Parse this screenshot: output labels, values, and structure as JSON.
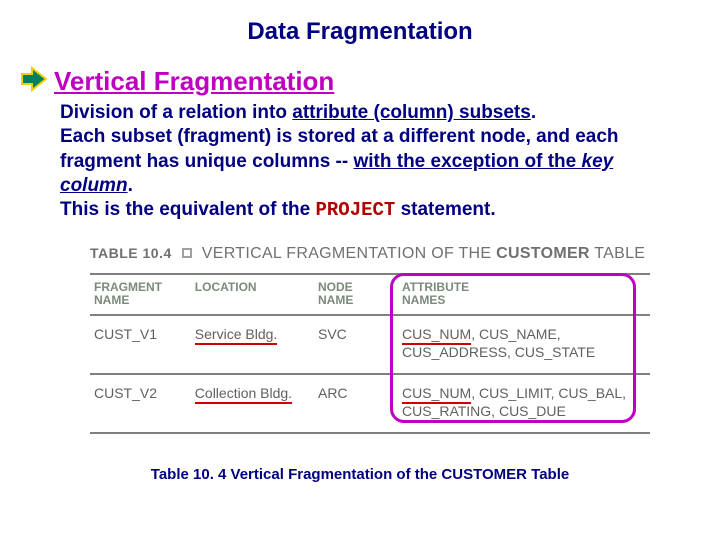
{
  "title": "Data Fragmentation",
  "section": {
    "heading": "Vertical Fragmentation",
    "bullet_shape": "right-arrow-block",
    "body_parts": {
      "p1a": "Division of a relation into ",
      "p1b": "attribute (column) subsets",
      "p1c": ".",
      "p2a": "Each subset (fragment) is stored at a different node, and each fragment has unique columns -- ",
      "p2b": "with the exception of the ",
      "p2c": "key column",
      "p2d": ".",
      "p3a": "This is the equivalent of the ",
      "p3code": "PROJECT",
      "p3b": " statement."
    }
  },
  "table": {
    "label": "TABLE 10.4",
    "title_plain": "VERTICAL FRAGMENTATION OF THE ",
    "title_bold": "CUSTOMER",
    "title_tail": " TABLE",
    "headers": {
      "fragment": "FRAGMENT\nNAME",
      "location": "LOCATION",
      "node": "NODE\nNAME",
      "attrs": "ATTRIBUTE\nNAMES"
    },
    "rows": [
      {
        "fragment": "CUST_V1",
        "location": "Service Bldg.",
        "node": "SVC",
        "attr_first": "CUS_NUM",
        "attr_rest": ", CUS_NAME, CUS_ADDRESS, CUS_STATE"
      },
      {
        "fragment": "CUST_V2",
        "location": "Collection Bldg.",
        "node": "ARC",
        "attr_first": "CUS_NUM",
        "attr_rest": ", CUS_LIMIT, CUS_BAL, CUS_RATING, CUS_DUE"
      }
    ]
  },
  "caption": "Table 10. 4  Vertical Fragmentation of the CUSTOMER Table",
  "colors": {
    "heading_blue": "#000080",
    "accent_magenta": "#c000c0",
    "code_red": "#b00000",
    "bullet_green": "#008060",
    "bullet_yellow": "#f0d000"
  }
}
